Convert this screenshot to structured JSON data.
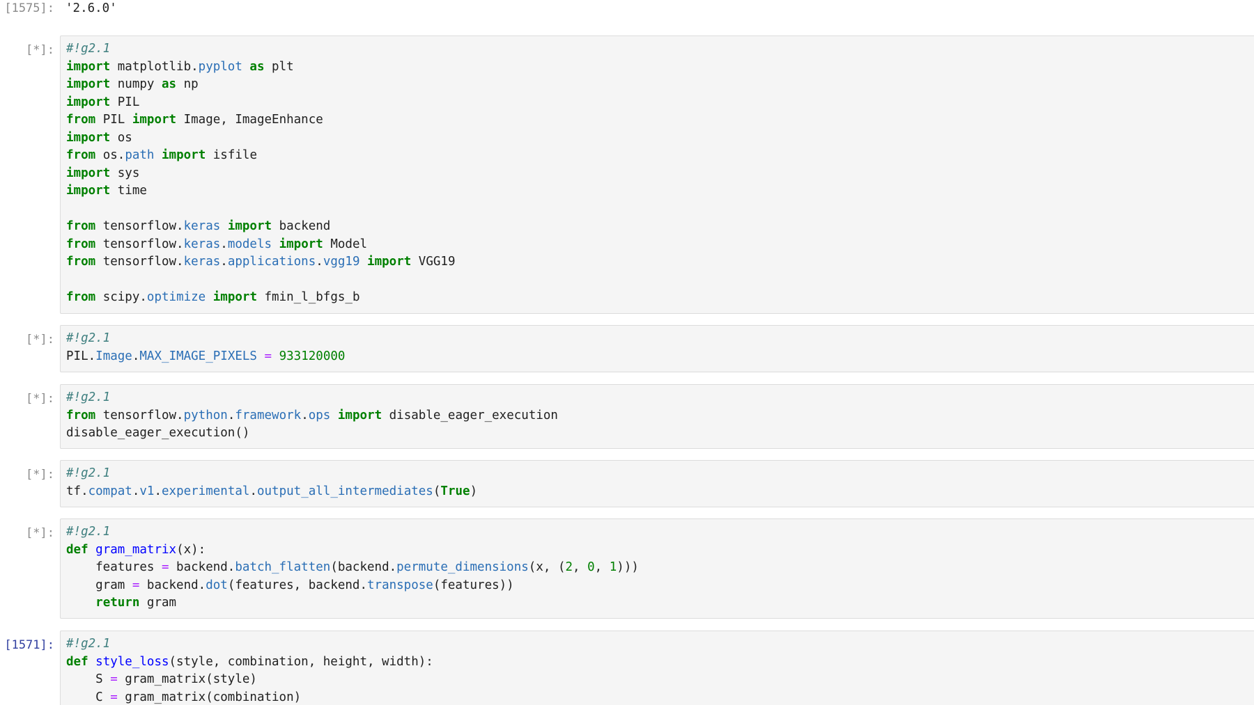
{
  "output_prev": {
    "prompt": "[1575]:",
    "text": "'2.6.0'"
  },
  "cells": [
    {
      "prompt": "[*]:",
      "lines": [
        [
          [
            "cm",
            "#!g2.1"
          ]
        ],
        [
          [
            "kw",
            "import"
          ],
          [
            "",
            " matplotlib."
          ],
          [
            "at",
            "pyplot"
          ],
          [
            "",
            " "
          ],
          [
            "kw",
            "as"
          ],
          [
            "",
            " plt"
          ]
        ],
        [
          [
            "kw",
            "import"
          ],
          [
            "",
            " numpy "
          ],
          [
            "kw",
            "as"
          ],
          [
            "",
            " np"
          ]
        ],
        [
          [
            "kw",
            "import"
          ],
          [
            "",
            " PIL"
          ]
        ],
        [
          [
            "kw",
            "from"
          ],
          [
            "",
            " PIL "
          ],
          [
            "kw",
            "import"
          ],
          [
            "",
            " Image, ImageEnhance"
          ]
        ],
        [
          [
            "kw",
            "import"
          ],
          [
            "",
            " os"
          ]
        ],
        [
          [
            "kw",
            "from"
          ],
          [
            "",
            " os."
          ],
          [
            "at",
            "path"
          ],
          [
            "",
            " "
          ],
          [
            "kw",
            "import"
          ],
          [
            "",
            " isfile"
          ]
        ],
        [
          [
            "kw",
            "import"
          ],
          [
            "",
            " sys"
          ]
        ],
        [
          [
            "kw",
            "import"
          ],
          [
            "",
            " time"
          ]
        ],
        [],
        [
          [
            "kw",
            "from"
          ],
          [
            "",
            " tensorflow."
          ],
          [
            "at",
            "keras"
          ],
          [
            "",
            " "
          ],
          [
            "kw",
            "import"
          ],
          [
            "",
            " backend"
          ]
        ],
        [
          [
            "kw",
            "from"
          ],
          [
            "",
            " tensorflow."
          ],
          [
            "at",
            "keras"
          ],
          [
            "",
            "."
          ],
          [
            "at",
            "models"
          ],
          [
            "",
            " "
          ],
          [
            "kw",
            "import"
          ],
          [
            "",
            " Model"
          ]
        ],
        [
          [
            "kw",
            "from"
          ],
          [
            "",
            " tensorflow."
          ],
          [
            "at",
            "keras"
          ],
          [
            "",
            "."
          ],
          [
            "at",
            "applications"
          ],
          [
            "",
            "."
          ],
          [
            "at",
            "vgg19"
          ],
          [
            "",
            " "
          ],
          [
            "kw",
            "import"
          ],
          [
            "",
            " VGG19"
          ]
        ],
        [],
        [
          [
            "kw",
            "from"
          ],
          [
            "",
            " scipy."
          ],
          [
            "at",
            "optimize"
          ],
          [
            "",
            " "
          ],
          [
            "kw",
            "import"
          ],
          [
            "",
            " fmin_l_bfgs_b"
          ]
        ]
      ]
    },
    {
      "prompt": "[*]:",
      "lines": [
        [
          [
            "cm",
            "#!g2.1"
          ]
        ],
        [
          [
            "",
            "PIL."
          ],
          [
            "at",
            "Image"
          ],
          [
            "",
            "."
          ],
          [
            "at",
            "MAX_IMAGE_PIXELS"
          ],
          [
            "",
            " "
          ],
          [
            "op",
            "="
          ],
          [
            "",
            " "
          ],
          [
            "nm",
            "933120000"
          ]
        ]
      ]
    },
    {
      "prompt": "[*]:",
      "lines": [
        [
          [
            "cm",
            "#!g2.1"
          ]
        ],
        [
          [
            "kw",
            "from"
          ],
          [
            "",
            " tensorflow."
          ],
          [
            "at",
            "python"
          ],
          [
            "",
            "."
          ],
          [
            "at",
            "framework"
          ],
          [
            "",
            "."
          ],
          [
            "at",
            "ops"
          ],
          [
            "",
            " "
          ],
          [
            "kw",
            "import"
          ],
          [
            "",
            " disable_eager_execution"
          ]
        ],
        [
          [
            "",
            "disable_eager_execution()"
          ]
        ]
      ]
    },
    {
      "prompt": "[*]:",
      "lines": [
        [
          [
            "cm",
            "#!g2.1"
          ]
        ],
        [
          [
            "",
            "tf."
          ],
          [
            "at",
            "compat"
          ],
          [
            "",
            "."
          ],
          [
            "at",
            "v1"
          ],
          [
            "",
            "."
          ],
          [
            "at",
            "experimental"
          ],
          [
            "",
            "."
          ],
          [
            "at",
            "output_all_intermediates"
          ],
          [
            "",
            "("
          ],
          [
            "kw",
            "True"
          ],
          [
            "",
            ")"
          ]
        ]
      ]
    },
    {
      "prompt": "[*]:",
      "lines": [
        [
          [
            "cm",
            "#!g2.1"
          ]
        ],
        [
          [
            "kw",
            "def"
          ],
          [
            "",
            " "
          ],
          [
            "nf",
            "gram_matrix"
          ],
          [
            "",
            "(x):"
          ]
        ],
        [
          [
            "",
            "    features "
          ],
          [
            "op",
            "="
          ],
          [
            "",
            " backend."
          ],
          [
            "at",
            "batch_flatten"
          ],
          [
            "",
            "(backend."
          ],
          [
            "at",
            "permute_dimensions"
          ],
          [
            "",
            "(x, ("
          ],
          [
            "nm",
            "2"
          ],
          [
            "",
            ", "
          ],
          [
            "nm",
            "0"
          ],
          [
            "",
            ", "
          ],
          [
            "nm",
            "1"
          ],
          [
            "",
            ")))"
          ]
        ],
        [
          [
            "",
            "    gram "
          ],
          [
            "op",
            "="
          ],
          [
            "",
            " backend."
          ],
          [
            "at",
            "dot"
          ],
          [
            "",
            "(features, backend."
          ],
          [
            "at",
            "transpose"
          ],
          [
            "",
            "(features))"
          ]
        ],
        [
          [
            "",
            "    "
          ],
          [
            "kw",
            "return"
          ],
          [
            "",
            " gram"
          ]
        ]
      ]
    },
    {
      "prompt": "[1571]:",
      "lines": [
        [
          [
            "cm",
            "#!g2.1"
          ]
        ],
        [
          [
            "kw",
            "def"
          ],
          [
            "",
            " "
          ],
          [
            "nf",
            "style_loss"
          ],
          [
            "",
            "(style, combination, height, width):"
          ]
        ],
        [
          [
            "",
            "    S "
          ],
          [
            "op",
            "="
          ],
          [
            "",
            " gram_matrix(style)"
          ]
        ],
        [
          [
            "",
            "    C "
          ],
          [
            "op",
            "="
          ],
          [
            "",
            " gram_matrix(combination)"
          ]
        ]
      ]
    }
  ]
}
